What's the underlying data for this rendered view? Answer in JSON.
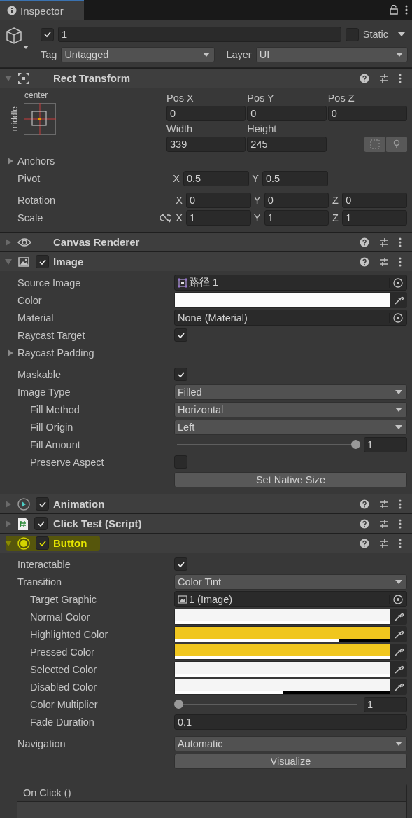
{
  "tab": {
    "title": "Inspector"
  },
  "object": {
    "active": true,
    "name": "1",
    "static": false,
    "static_label": "Static",
    "tag_label": "Tag",
    "tag": "Untagged",
    "layer_label": "Layer",
    "layer": "UI"
  },
  "components": [
    {
      "kind": "rect",
      "title": "Rect Transform",
      "expanded": true,
      "highlighted": false,
      "anchor": {
        "horizontal": "center",
        "vertical": "middle"
      },
      "position": [
        {
          "label": "Pos X",
          "value": "0"
        },
        {
          "label": "Pos Y",
          "value": "0"
        },
        {
          "label": "Pos Z",
          "value": "0"
        }
      ],
      "size": [
        {
          "label": "Width",
          "value": "339"
        },
        {
          "label": "Height",
          "value": "245"
        }
      ],
      "groups": [
        [
          {
            "kind": "foldout",
            "label": "Anchors",
            "expanded": false
          },
          {
            "kind": "vector",
            "label": "Pivot",
            "axes": [
              {
                "axis": "X",
                "value": "0.5"
              },
              {
                "axis": "Y",
                "value": "0.5"
              }
            ]
          }
        ],
        [
          {
            "kind": "vector",
            "label": "Rotation",
            "axes": [
              {
                "axis": "X",
                "value": "0"
              },
              {
                "axis": "Y",
                "value": "0"
              },
              {
                "axis": "Z",
                "value": "0"
              }
            ]
          },
          {
            "kind": "vector",
            "label": "Scale",
            "linked": false,
            "axes": [
              {
                "axis": "X",
                "value": "1"
              },
              {
                "axis": "Y",
                "value": "1"
              },
              {
                "axis": "Z",
                "value": "1"
              }
            ]
          }
        ]
      ]
    },
    {
      "kind": "canvas",
      "title": "Canvas Renderer",
      "expanded": false,
      "highlighted": false
    },
    {
      "kind": "image",
      "title": "Image",
      "enabled": true,
      "expanded": true,
      "highlighted": false,
      "groups": [
        [
          {
            "kind": "sprite-ref",
            "label": "Source Image",
            "value": "路径 1"
          },
          {
            "kind": "color",
            "label": "Color",
            "color": "#ffffff",
            "level": 1
          },
          {
            "kind": "object",
            "label": "Material",
            "value": "None (Material)"
          },
          {
            "kind": "check",
            "label": "Raycast Target",
            "checked": true
          },
          {
            "kind": "foldout",
            "label": "Raycast Padding",
            "expanded": false
          }
        ],
        [
          {
            "kind": "check",
            "label": "Maskable",
            "checked": true
          },
          {
            "kind": "dropdown",
            "label": "Image Type",
            "value": "Filled",
            "children": [
              {
                "kind": "dropdown",
                "label": "Fill Method",
                "value": "Horizontal"
              },
              {
                "kind": "dropdown",
                "label": "Fill Origin",
                "value": "Left"
              },
              {
                "kind": "slider",
                "label": "Fill Amount",
                "level": 1,
                "value": "1"
              },
              {
                "kind": "check",
                "label": "Preserve Aspect",
                "checked": false
              }
            ]
          },
          {
            "kind": "button",
            "label": "Set Native Size"
          }
        ]
      ]
    },
    {
      "kind": "animation",
      "title": "Animation",
      "enabled": true,
      "expanded": false,
      "highlighted": false
    },
    {
      "kind": "script",
      "title": "Click Test (Script)",
      "enabled": true,
      "expanded": false,
      "highlighted": false
    },
    {
      "kind": "button",
      "title": "Button",
      "enabled": true,
      "expanded": true,
      "highlighted": true,
      "groups": [
        [
          {
            "kind": "check",
            "label": "Interactable",
            "checked": true
          },
          {
            "kind": "dropdown",
            "label": "Transition",
            "value": "Color Tint",
            "children": [
              {
                "kind": "image-ref",
                "label": "Target Graphic",
                "value": "1 (Image)"
              },
              {
                "kind": "color",
                "label": "Normal Color",
                "color": "#f5f5f5",
                "level": 1
              },
              {
                "kind": "color",
                "label": "Highlighted Color",
                "color": "#f0c61e",
                "level": 0.76
              },
              {
                "kind": "color",
                "label": "Pressed Color",
                "color": "#f0c61e",
                "level": 1
              },
              {
                "kind": "color",
                "label": "Selected Color",
                "color": "#f5f5f5",
                "level": 1
              },
              {
                "kind": "color",
                "label": "Disabled Color",
                "color": "#f5f5f5",
                "level": 0.5
              },
              {
                "kind": "slider",
                "label": "Color Multiplier",
                "level": 0,
                "value": "1"
              },
              {
                "kind": "text",
                "label": "Fade Duration",
                "value": "0.1"
              }
            ]
          }
        ],
        [
          {
            "kind": "dropdown",
            "label": "Navigation",
            "value": "Automatic"
          },
          {
            "kind": "button",
            "label": "Visualize"
          }
        ]
      ],
      "event": {
        "title": "On Click ()"
      }
    }
  ]
}
